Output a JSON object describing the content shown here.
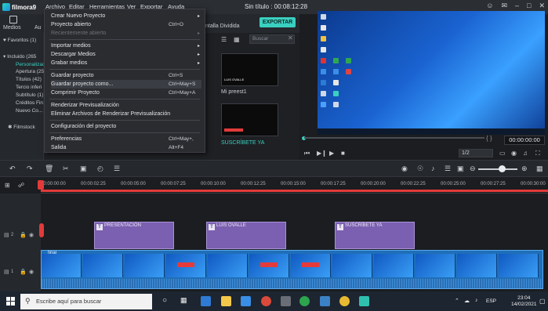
{
  "titlebar": {
    "app_name": "filmora9",
    "menus": [
      "Archivo",
      "Editar",
      "Herramientas",
      "Ver",
      "Exportar",
      "Ayuda"
    ],
    "project_title": "Sin título : 00:08:12:28"
  },
  "media_tabs": [
    "Medios",
    "Au"
  ],
  "left_panel": {
    "favoritos": "Favoritos (1)",
    "incluido": "Incluido (265",
    "items": [
      "Personalizado",
      "Apertura (25)",
      "Títulos (42)",
      "Tercio inferi",
      "Subtítulo (1)",
      "Créditos Fin",
      "Nuevo Co..."
    ],
    "filmstock": "Filmstock"
  },
  "media": {
    "tab_split": "ntalla Dividida",
    "export_label": "EXPORTAR",
    "search_placeholder": "Buscar",
    "thumbs": [
      {
        "label": "Mi preest1",
        "inner": "LUIS OVALLE"
      },
      {
        "label": "SUSCRÍBETE YA",
        "inner": "SUSCRÍBETE"
      }
    ]
  },
  "dropdown": {
    "items": [
      {
        "label": "Crear Nuevo Proyecto",
        "shortcut": "",
        "submenu": true,
        "disabled": false
      },
      {
        "label": "Proyecto abierto",
        "shortcut": "Ctrl+O",
        "submenu": false,
        "disabled": false
      },
      {
        "label": "Recientemente abierto",
        "shortcut": "",
        "submenu": true,
        "disabled": true
      },
      {
        "label": "Importar medios",
        "shortcut": "",
        "submenu": true,
        "disabled": false
      },
      {
        "label": "Descargar Medios",
        "shortcut": "",
        "submenu": true,
        "disabled": false
      },
      {
        "label": "Grabar medios",
        "shortcut": "",
        "submenu": true,
        "disabled": false
      },
      {
        "label": "Guardar proyecto",
        "shortcut": "Ctrl+S",
        "submenu": false,
        "disabled": false
      },
      {
        "label": "Guardar proyecto como...",
        "shortcut": "Ctrl+May+S",
        "submenu": false,
        "disabled": false
      },
      {
        "label": "Comprimir Proyecto",
        "shortcut": "Ctrl+May+A",
        "submenu": false,
        "disabled": false
      },
      {
        "label": "Renderizar Previsualización",
        "shortcut": "",
        "submenu": false,
        "disabled": false
      },
      {
        "label": "Eliminar Archivos de Renderizar Previsualización",
        "shortcut": "",
        "submenu": false,
        "disabled": false
      },
      {
        "label": "Configuración del proyecto",
        "shortcut": "",
        "submenu": false,
        "disabled": false
      },
      {
        "label": "Preferencias",
        "shortcut": "Ctrl+May+,",
        "submenu": false,
        "disabled": false
      },
      {
        "label": "Salida",
        "shortcut": "Alt+F4",
        "submenu": false,
        "disabled": false
      }
    ]
  },
  "preview": {
    "timecode": "00:00:00:00",
    "ratio": "1/2"
  },
  "timeline": {
    "ticks": [
      "00:00:00:00",
      "00:00:02:25",
      "00:00:05:00",
      "00:00:07:25",
      "00:00:10:00",
      "00:00:12:25",
      "00:00:15:00",
      "00:00:17:25",
      "00:00:20:00",
      "00:00:22:25",
      "00:00:25:00",
      "00:00:27:25",
      "00:00:30:00"
    ],
    "title_clips": [
      "PRESENTACIÓN",
      "LUIS OVALLE",
      "SUSCRÍBETE YA"
    ],
    "video_clip_label": "final",
    "track2": "2",
    "track1": "1"
  },
  "taskbar": {
    "search_placeholder": "Escribe aquí para buscar",
    "lang": "ESP",
    "time": "23:04",
    "date": "14/02/2021"
  }
}
